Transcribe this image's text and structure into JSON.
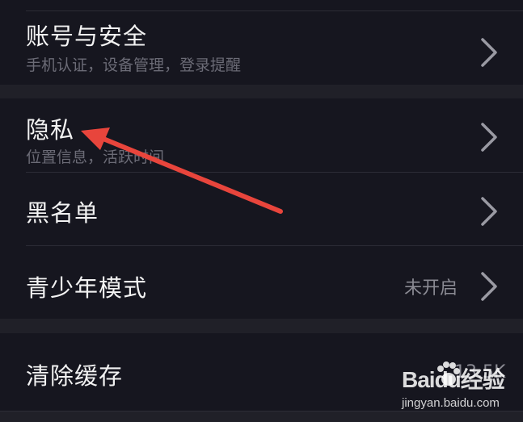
{
  "settings": {
    "rows": [
      {
        "title": "账号与安全",
        "subtitle": "手机认证，设备管理，登录提醒"
      },
      {
        "title": "隐私",
        "subtitle": "位置信息，活跃时间"
      },
      {
        "title": "黑名单"
      },
      {
        "title": "青少年模式",
        "value": "未开启"
      },
      {
        "title": "清除缓存",
        "value": "13.5K"
      }
    ]
  },
  "watermark": {
    "brand": "Baidu经验",
    "url": "jingyan.baidu.com"
  },
  "colors": {
    "background": "#16161f",
    "section_gap": "#202028",
    "arrow": "#e8453c"
  },
  "icons": [
    "chevron-right-icon",
    "red-arrow-annotation",
    "baidu-paw-icon"
  ]
}
